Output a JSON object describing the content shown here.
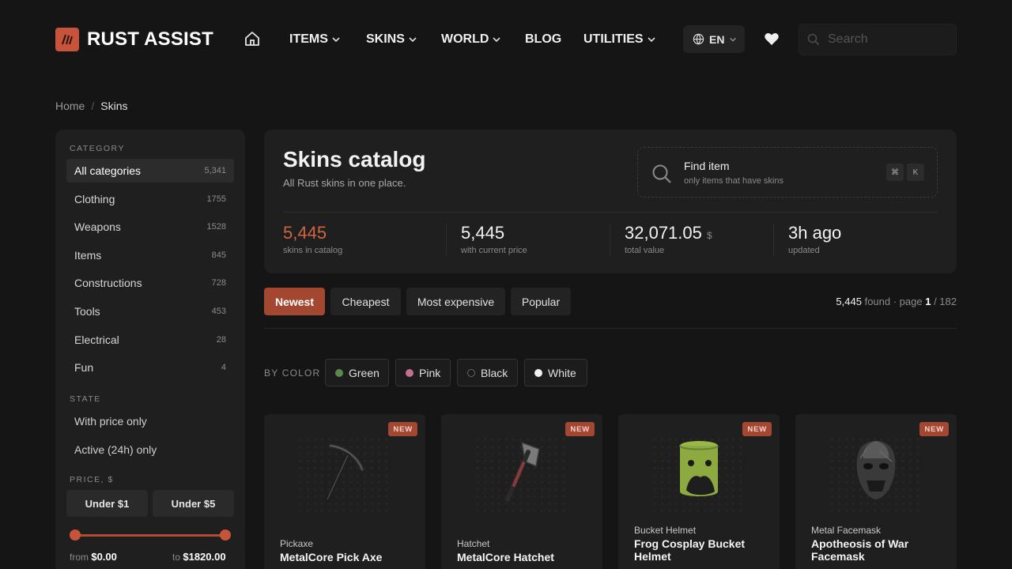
{
  "header": {
    "logo_text": "RUST ASSIST",
    "nav": [
      {
        "label": "ITEMS",
        "has_dropdown": true
      },
      {
        "label": "SKINS",
        "has_dropdown": true
      },
      {
        "label": "WORLD",
        "has_dropdown": true
      },
      {
        "label": "BLOG",
        "has_dropdown": false
      },
      {
        "label": "UTILITIES",
        "has_dropdown": true
      }
    ],
    "language": "EN",
    "search_placeholder": "Search"
  },
  "breadcrumb": {
    "home": "Home",
    "current": "Skins"
  },
  "sidebar": {
    "category_heading": "CATEGORY",
    "categories": [
      {
        "label": "All categories",
        "count": "5,341",
        "active": true
      },
      {
        "label": "Clothing",
        "count": "1755"
      },
      {
        "label": "Weapons",
        "count": "1528"
      },
      {
        "label": "Items",
        "count": "845"
      },
      {
        "label": "Constructions",
        "count": "728"
      },
      {
        "label": "Tools",
        "count": "453"
      },
      {
        "label": "Electrical",
        "count": "28"
      },
      {
        "label": "Fun",
        "count": "4"
      }
    ],
    "state_heading": "STATE",
    "states": [
      "With price only",
      "Active (24h) only"
    ],
    "price_heading": "PRICE, $",
    "price_buttons": [
      "Under $1",
      "Under $5"
    ],
    "range_from_label": "from",
    "range_from": "$0.00",
    "range_to_label": "to",
    "range_to": "$1820.00"
  },
  "catalog": {
    "title": "Skins catalog",
    "subtitle": "All Rust skins in one place.",
    "finder_title": "Find item",
    "finder_sub": "only items that have skins",
    "kbd": [
      "⌘",
      "K"
    ],
    "stats": [
      {
        "value": "5,445",
        "label": "skins in catalog",
        "unit": ""
      },
      {
        "value": "5,445",
        "label": "with current price",
        "unit": ""
      },
      {
        "value": "32,071.05",
        "label": "total value",
        "unit": "$"
      },
      {
        "value": "3h ago",
        "label": "updated",
        "unit": ""
      }
    ]
  },
  "sorting": {
    "options": [
      "Newest",
      "Cheapest",
      "Most expensive",
      "Popular"
    ],
    "active": "Newest",
    "results_count": "5,445",
    "results_text": "found · page",
    "page": "1",
    "pages_text": "/ 182"
  },
  "color_filter": {
    "label": "BY COLOR",
    "chips": [
      {
        "label": "Green",
        "color": "#5a8a4a"
      },
      {
        "label": "Pink",
        "color": "#c07090"
      },
      {
        "label": "Black",
        "color": "#1a1a1a"
      },
      {
        "label": "White",
        "color": "#f0f0f0"
      }
    ]
  },
  "items": [
    {
      "type": "Pickaxe",
      "name": "MetalCore Pick Axe",
      "badge": "NEW",
      "icon": "pickaxe-icon"
    },
    {
      "type": "Hatchet",
      "name": "MetalCore Hatchet",
      "badge": "NEW",
      "icon": "hatchet-icon"
    },
    {
      "type": "Bucket Helmet",
      "name": "Frog Cosplay Bucket Helmet",
      "badge": "NEW",
      "icon": "bucket-helmet-icon"
    },
    {
      "type": "Metal Facemask",
      "name": "Apotheosis of War Facemask",
      "badge": "NEW",
      "icon": "facemask-icon"
    }
  ],
  "colors": {
    "accent": "#c7533a",
    "background": "#151515",
    "panel": "#1f1f1f"
  }
}
